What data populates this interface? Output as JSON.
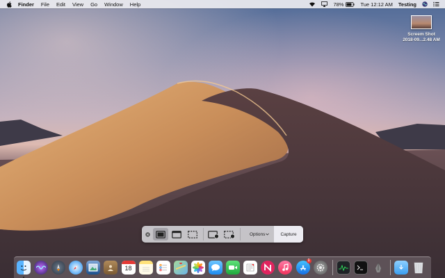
{
  "menubar": {
    "app_name": "Finder",
    "items": [
      "File",
      "Edit",
      "View",
      "Go",
      "Window",
      "Help"
    ],
    "battery": "78%",
    "clock": "Tue 12:12 AM",
    "user": "Testing"
  },
  "desktop": {
    "file_name": "Screem Shot",
    "file_date": "2018-09...2.48 AM"
  },
  "screenshot_toolbar": {
    "options_label": "Options",
    "capture_label": "Capture"
  },
  "dock": {
    "calendar_day": "18",
    "appstore_badge": "1"
  },
  "colors": {
    "accent_blue": "#1e8cf0",
    "menubar_bg": "#ececf0"
  }
}
